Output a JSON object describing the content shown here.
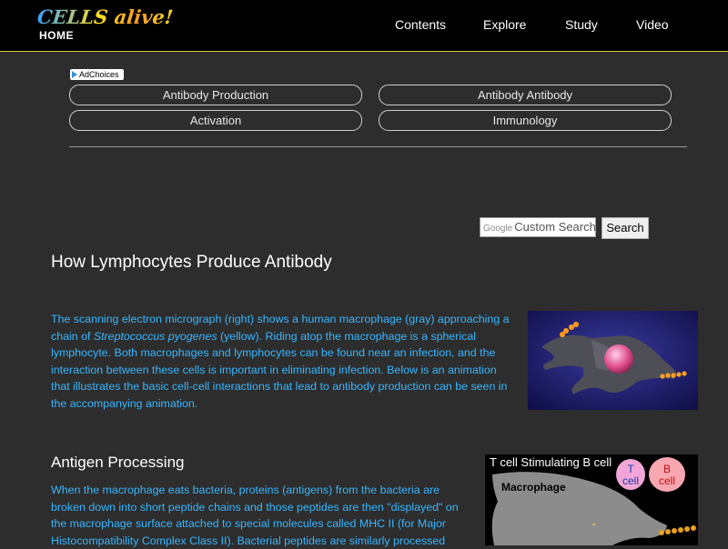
{
  "header": {
    "logo_text": "CELLS alive!",
    "home_label": "HOME",
    "nav": [
      "Contents",
      "Explore",
      "Study",
      "Video"
    ]
  },
  "ad": {
    "adchoices_label": "AdChoices",
    "links": [
      "Antibody Production",
      "Antibody Antibody",
      "Activation",
      "Immunology"
    ]
  },
  "search": {
    "google_label": "Google",
    "placeholder": "Custom Search",
    "button_label": "Search"
  },
  "article": {
    "title": "How Lymphocytes Produce Antibody",
    "intro": {
      "part1": "The scanning electron micrograph (right) shows a human macrophage (gray) approaching a chain of ",
      "italic": "Streptococcus pyogenes",
      "part2": " (yellow). Riding atop the macrophage is a spherical lymphocyte. Both macrophages and lymphocytes can be found near an infection, and the interaction between these cells is important in eliminating infection. Below is an animation that illustrates the basic cell-cell interactions that lead to antibody production can be seen in the accompanying animation."
    },
    "section_title": "Antigen Processing",
    "section_text": "When the macrophage eats bacteria, proteins (antigens) from the bacteria are broken down into short peptide chains and those peptides are then \"displayed\" on the macrophage surface attached to special molecules called MHC II (for Major Histocompatibility Complex Class II). Bacterial peptides are similarly processed"
  },
  "figure2": {
    "title": "T cell Stimulating B cell",
    "macrophage_label": "Macrophage",
    "t_cell_label": "T cell",
    "b_cell_label": "B cell"
  },
  "colors": {
    "background": "#2d2d2d",
    "link_text": "#38b6ff",
    "header_bg": "#000000",
    "accent_line": "#c8c840"
  }
}
